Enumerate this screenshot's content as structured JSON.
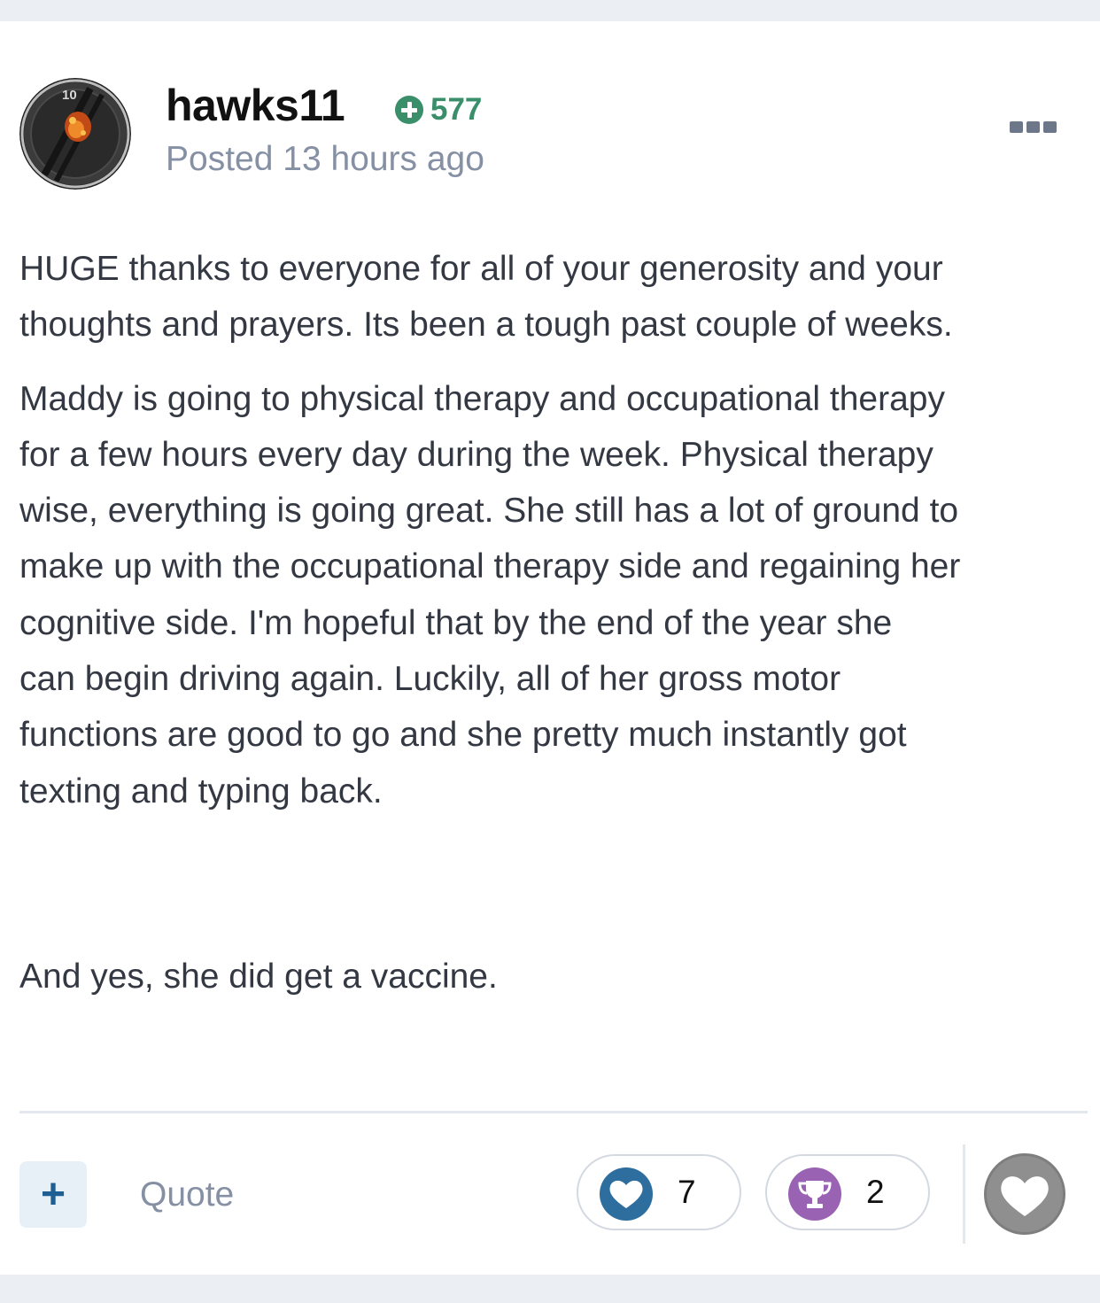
{
  "post": {
    "author": {
      "username": "hawks11",
      "reputation": "577",
      "avatar_badge": "10"
    },
    "posted": "Posted 13 hours ago",
    "body": {
      "p1_lines": [
        "HUGE thanks to everyone for all of your generosity and your",
        "thoughts and prayers.  Its been a tough past couple of weeks."
      ],
      "p2_lines": [
        "Maddy is going to physical therapy and occupational therapy",
        "for a few hours every day during the week.  Physical therapy",
        "wise, everything is going great.  She still has a lot of ground to",
        "make up with the occupational therapy side and regaining her",
        "cognitive side.  I'm hopeful that by the end of the year she",
        "can begin driving again. Luckily, all of her gross motor",
        "functions are good to go and she pretty much instantly got",
        "texting and typing back."
      ],
      "p3_lines": [
        "And yes, she did get a vaccine."
      ]
    }
  },
  "actions": {
    "add_label": "+",
    "quote_label": "Quote"
  },
  "reactions": [
    {
      "name": "like",
      "icon": "heart-icon",
      "count": "7",
      "color": "#2d6e9f"
    },
    {
      "name": "thanks",
      "icon": "trophy-icon",
      "count": "2",
      "color": "#9a62b3"
    }
  ],
  "react_button_icon": "heart-icon",
  "colors": {
    "reputation": "#3a8f6a",
    "username": "#111111",
    "meta_text": "#8590a4",
    "body_text": "#333842",
    "accent_blue": "#1d5e93"
  }
}
